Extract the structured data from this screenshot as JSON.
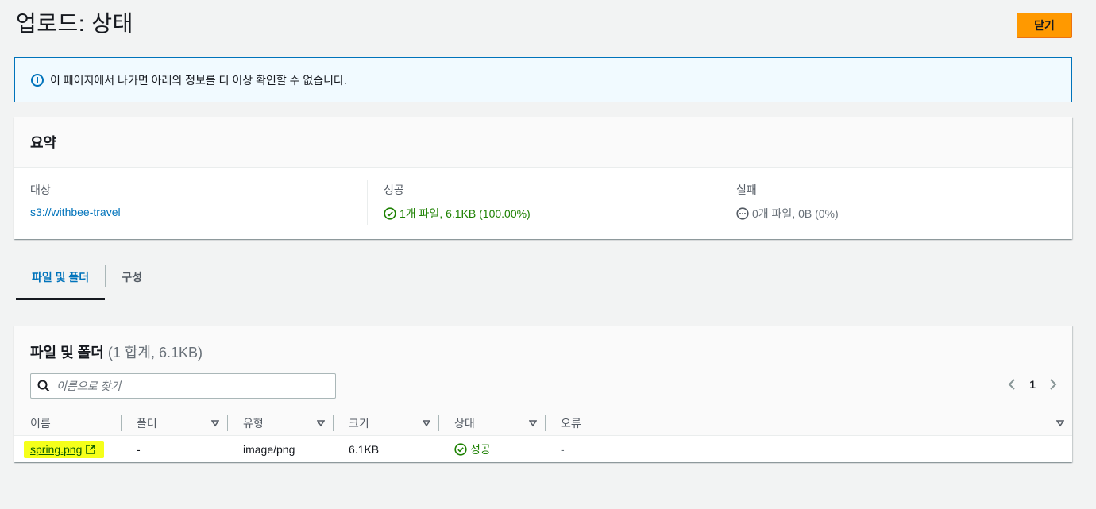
{
  "header": {
    "title": "업로드: 상태",
    "close_label": "닫기"
  },
  "alert": {
    "message": "이 페이지에서 나가면 아래의 정보를 더 이상 확인할 수 없습니다."
  },
  "summary": {
    "title": "요약",
    "destination": {
      "label": "대상",
      "value": "s3://withbee-travel"
    },
    "succeeded": {
      "label": "성공",
      "value": "1개 파일, 6.1KB (100.00%)"
    },
    "failed": {
      "label": "실패",
      "value": "0개 파일, 0B (0%)"
    }
  },
  "tabs": [
    {
      "label": "파일 및 폴더",
      "active": true
    },
    {
      "label": "구성",
      "active": false
    }
  ],
  "files": {
    "title": "파일 및 폴더",
    "count": "(1 합계, 6.1KB)",
    "search_placeholder": "이름으로 찾기",
    "page": "1",
    "columns": [
      "이름",
      "폴더",
      "유형",
      "크기",
      "상태",
      "오류"
    ],
    "rows": [
      {
        "name": "spring.png",
        "folder": "-",
        "type": "image/png",
        "size": "6.1KB",
        "status": "성공",
        "error": "-"
      }
    ]
  },
  "colors": {
    "accent": "#ff9900",
    "link": "#0073bb",
    "success": "#1d8102",
    "highlight": "#f5ff1a"
  }
}
